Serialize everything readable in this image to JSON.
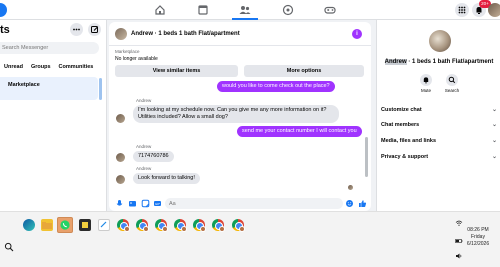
{
  "topbar": {
    "notification_count": "20+",
    "nav_icons": [
      "home-icon",
      "pages-icon",
      "friends-icon",
      "marketplace-icon",
      "gaming-icon"
    ],
    "active_nav": "friends-icon"
  },
  "sidebar": {
    "title_partial": "ts",
    "search_placeholder": "Search Messenger",
    "filters": [
      "Unread",
      "Groups",
      "Communities"
    ],
    "selected_item": "Marketplace"
  },
  "chat": {
    "title": "Andrew · 1 beds 1 bath Flat/apartment",
    "listing": {
      "label": "Marketplace",
      "status": "No longer available",
      "view_similar": "View similar items",
      "more_options": "More options"
    },
    "messages": [
      {
        "dir": "out",
        "text": "would you like to come check out the place?"
      },
      {
        "dir": "in",
        "sender": "Andrew",
        "text": "I'm looking at my schedule now. Can you give me any more information on it? Utilities included? Allow a small dog?"
      },
      {
        "dir": "out",
        "text": "send me your contact number I will contact you"
      },
      {
        "dir": "in",
        "sender": "Andrew",
        "text": "7174760786"
      },
      {
        "dir": "in",
        "sender": "Andrew",
        "text": "Look forward to talking!"
      }
    ],
    "composer_placeholder": "Aa"
  },
  "info_panel": {
    "name_highlight": "Andrew",
    "name_rest": " · 1 beds 1 bath Flat/apartment",
    "actions": [
      "Mute",
      "Search"
    ],
    "sections": [
      "Customize chat",
      "Chat members",
      "Media, files and links",
      "Privacy & support"
    ]
  },
  "taskbar": {
    "time": "08:26 PM",
    "day": "Friday",
    "date": "6/12/2026"
  },
  "colors": {
    "accent_purple": "#a033ff",
    "facebook_blue": "#1877f2",
    "selected_bg": "#e9f1fd"
  }
}
